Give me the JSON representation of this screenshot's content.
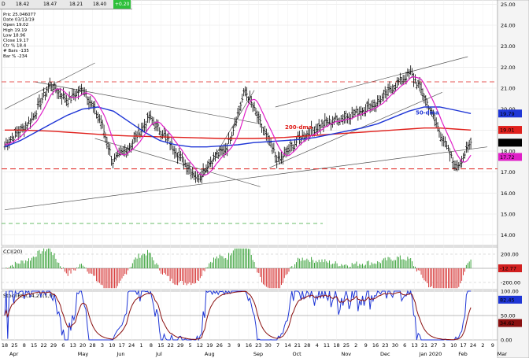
{
  "toolbar": {
    "symbol_marker": "D",
    "open": "18.42",
    "high": "18.47",
    "low": "18.21",
    "close": "18.40",
    "change": "+0.20"
  },
  "info_box": [
    "Pric 25.046077",
    "Date 03/13/19",
    "Open 19.02",
    "High 19.19",
    "Low 18.96",
    "Close 19.17",
    "Ctr % 18.4",
    "# Bars -135",
    "Bar % -234"
  ],
  "colors": {
    "price_bars": "#000000",
    "ma_200": "#e0201c",
    "ma_50": "#1f36d6",
    "ma_10": "#e020c8",
    "support": "#e0201c",
    "green_dash": "#3aa83a",
    "cci_pos": "#2a9a2a",
    "cci_neg": "#d22020",
    "stoch_fast": "#1f36d6",
    "stoch_slow": "#8a1010",
    "axis_bg": "#ffffff"
  },
  "annotations": {
    "ma200_label": "200-dma",
    "ma50_label": "50-dma"
  },
  "price_axis": {
    "ticks": [
      "25.00",
      "24.00",
      "23.00",
      "22.00",
      "21.00",
      "20.00",
      "19.00",
      "18.00",
      "17.00",
      "16.00",
      "15.00",
      "14.00"
    ],
    "badges": [
      {
        "text": "19.79",
        "color": "#1f36d6"
      },
      {
        "text": "19.01",
        "color": "#e0201c"
      },
      {
        "text": "18.40",
        "color": "#000000"
      },
      {
        "text": "17.72",
        "color": "#e020c8"
      }
    ]
  },
  "cci_panel": {
    "title": "CCI(20)",
    "ticks": [
      "200.00",
      "-200.00"
    ],
    "value_badge": "-12.77"
  },
  "stoch_panel": {
    "title": "StochRSI(14,21(1,9)",
    "ticks": [
      "100.00",
      "50.00",
      "0.00"
    ],
    "badges": [
      {
        "text": "82.45",
        "color": "#1f36d6"
      },
      {
        "text": "34.62",
        "color": "#8a1010"
      }
    ]
  },
  "x_axis": {
    "day_ticks": [
      "18",
      "25",
      "8",
      "15",
      "22",
      "29",
      "6",
      "13",
      "20",
      "28",
      "3",
      "10",
      "17",
      "24",
      "1",
      "8",
      "15",
      "22",
      "29",
      "5",
      "12",
      "19",
      "26",
      "3",
      "9",
      "16",
      "23",
      "30",
      "7",
      "14",
      "21",
      "28",
      "4",
      "11",
      "18",
      "25",
      "2",
      "9",
      "16",
      "23",
      "30",
      "6",
      "13",
      "21",
      "27",
      "3",
      "10",
      "17",
      "24",
      "2",
      "9"
    ],
    "month_labels": [
      "Apr",
      "May",
      "Jun",
      "Jul",
      "Aug",
      "Sep",
      "Oct",
      "Nov",
      "Dec",
      "Jan 2020",
      "Feb",
      "Mar"
    ]
  },
  "chart_data": {
    "type": "line",
    "title": "",
    "price_range": [
      13.5,
      25.2
    ],
    "series": [
      {
        "name": "200-dma",
        "values": [
          19.0,
          19.0,
          18.98,
          18.95,
          18.9,
          18.85,
          18.8,
          18.75,
          18.72,
          18.7,
          18.68,
          18.66,
          18.64,
          18.62,
          18.6,
          18.6,
          18.6,
          18.62,
          18.65,
          18.7,
          18.75,
          18.8,
          18.85,
          18.9,
          18.95,
          19.0,
          19.05,
          19.1,
          19.1,
          19.05,
          19.0
        ]
      },
      {
        "name": "50-dma",
        "values": [
          18.2,
          18.5,
          18.9,
          19.3,
          19.7,
          20.0,
          20.1,
          19.9,
          19.4,
          18.9,
          18.5,
          18.3,
          18.2,
          18.2,
          18.25,
          18.3,
          18.4,
          18.45,
          18.5,
          18.55,
          18.65,
          18.8,
          18.95,
          19.1,
          19.3,
          19.6,
          19.9,
          20.1,
          20.1,
          19.95,
          19.79
        ]
      }
    ],
    "support_level": 17.15,
    "resistance_level": 21.3,
    "lower_level": 14.55,
    "last_close": 18.4,
    "cci_range": [
      -300,
      300
    ],
    "stoch_range": [
      0,
      100
    ]
  }
}
